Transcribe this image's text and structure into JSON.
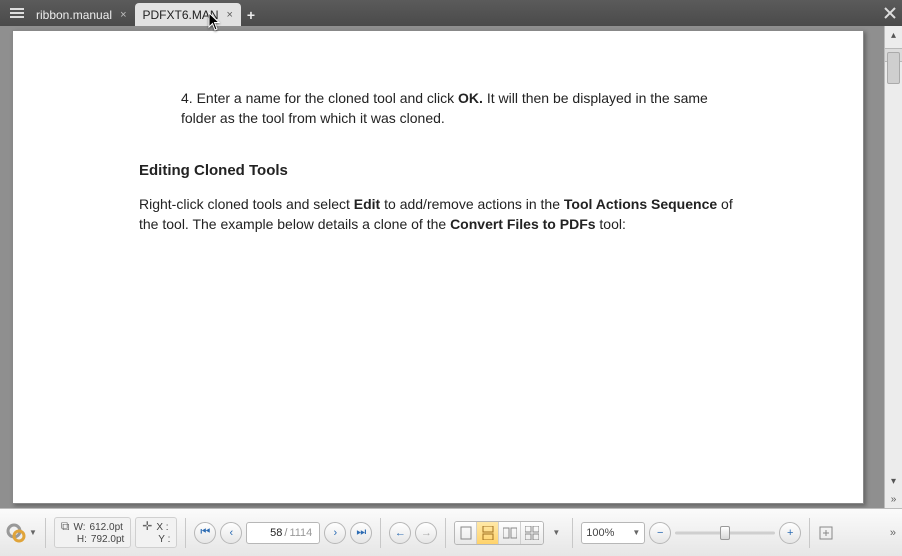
{
  "tabs": [
    {
      "label": "ribbon.manual",
      "active": false
    },
    {
      "label": "PDFXT6.MAN",
      "active": true
    }
  ],
  "doc": {
    "step4_prefix": "4. Enter a name for the cloned tool and click ",
    "step4_bold": "OK.",
    "step4_suffix": " It will then be displayed in the same folder as the tool from which it was cloned.",
    "heading": "Editing Cloned Tools",
    "para_a": "Right-click cloned tools and select ",
    "para_b1": "Edit",
    "para_c": " to add/remove actions in the ",
    "para_b2": "Tool Actions Sequence",
    "para_d": " of the tool. The example below details a clone of the ",
    "para_b3": "Convert Files to PDFs",
    "para_e": " tool:"
  },
  "measure": {
    "w_label": "W:",
    "w_value": "612.0pt",
    "h_label": "H:",
    "h_value": "792.0pt",
    "x_label": "X :",
    "y_label": "Y :"
  },
  "paging": {
    "current": "58",
    "total": "1114",
    "sep": "/"
  },
  "zoom": {
    "value": "100%"
  }
}
